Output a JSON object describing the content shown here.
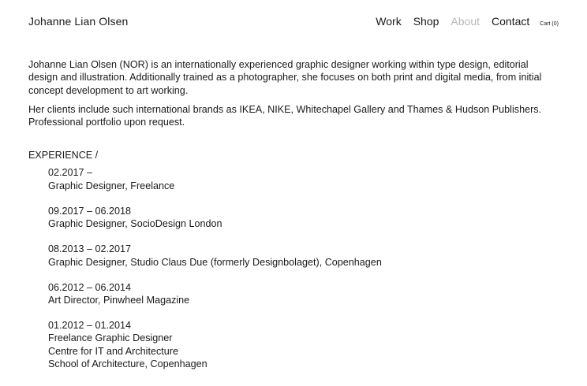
{
  "header": {
    "site_title": "Johanne Lian Olsen",
    "nav": {
      "work": "Work",
      "shop": "Shop",
      "about": "About",
      "contact": "Contact",
      "cart": "Cart (0)"
    }
  },
  "bio": {
    "paragraph_1": "Johanne Lian Olsen (NOR) is an internationally experienced graphic designer working within type design, editorial design and illustration. Additionally trained as a photographer, she focuses on both print and digital media, from initial concept development to art working.",
    "paragraph_2": "Her clients include such international brands as IKEA, NIKE, Whitechapel Gallery and Thames & Hudson Publishers. Professional portfolio upon request."
  },
  "experience": {
    "heading": "EXPERIENCE /",
    "items": [
      {
        "dates": "02.2017 –",
        "role": "Graphic Designer, Freelance"
      },
      {
        "dates": "09.2017 – 06.2018",
        "role": "Graphic Designer, SocioDesign London"
      },
      {
        "dates": "08.2013 – 02.2017",
        "role": "Graphic Designer, Studio Claus Due (formerly Designbolaget), Copenhagen"
      },
      {
        "dates": "06.2012 – 06.2014",
        "role": "Art Director, Pinwheel Magazine"
      },
      {
        "dates": "01.2012 – 01.2014",
        "role": "Freelance Graphic Designer",
        "extra_1": "Centre for IT and Architecture",
        "extra_2": "School of Architecture, Copenhagen"
      }
    ]
  },
  "colors": {
    "text": "#1a1a1a",
    "active_nav": "#b8b8b8",
    "background": "#ffffff"
  }
}
